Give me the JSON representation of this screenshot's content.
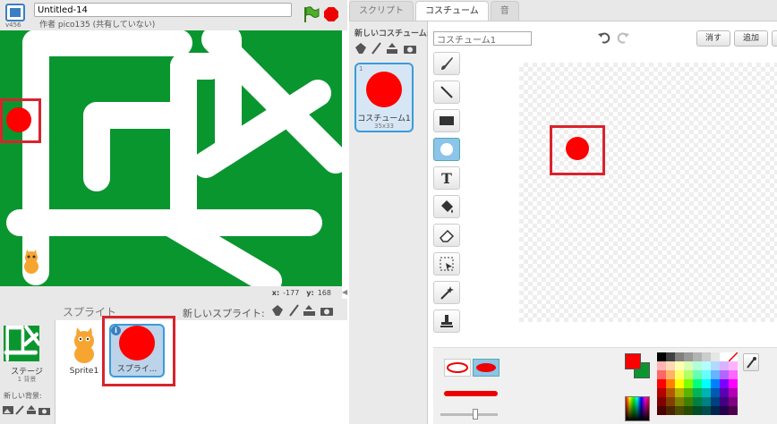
{
  "project": {
    "version": "v456",
    "title": "Untitled-14",
    "author": "作者 pico135 (共有していない)"
  },
  "stage_info": {
    "x_label": "x:",
    "x_value": "-177",
    "y_label": "y:",
    "y_value": "168"
  },
  "sprites_pane": {
    "title": "スプライト",
    "new_sprite_label": "新しいスプライト:",
    "stage_label": "ステージ",
    "stage_backdrops": "1 背景",
    "new_backdrop_label": "新しい背景:",
    "sprites": [
      {
        "name": "Sprite1"
      },
      {
        "name": "スプライ..."
      }
    ]
  },
  "tabs": [
    {
      "label": "スクリプト"
    },
    {
      "label": "コスチューム"
    },
    {
      "label": "音"
    }
  ],
  "costumes": {
    "new_costume_label": "新しいコスチューム:",
    "items": [
      {
        "index": "1",
        "name": "コスチューム1",
        "size": "35x33"
      }
    ]
  },
  "editor": {
    "costume_name": "コスチューム1",
    "clear_label": "消す",
    "add_label": "追加"
  },
  "colors": {
    "stage_bg": "#0a962f",
    "sprite_red": "#ff0000",
    "highlight": "#d9232e",
    "primary_color": "#ff0000",
    "secondary_color": "#0a962f"
  }
}
